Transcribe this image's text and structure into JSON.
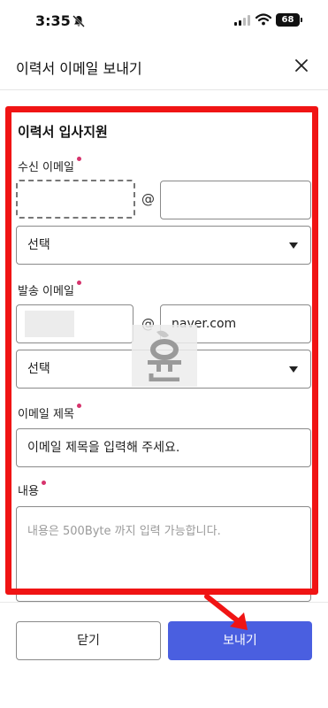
{
  "status_bar": {
    "time": "3:35",
    "battery": "68"
  },
  "header": {
    "title": "이력서 이메일 보내기"
  },
  "form": {
    "section_title": "이력서 입사지원",
    "recipient": {
      "label": "수신 이메일",
      "id_value": "",
      "at": "@",
      "domain_value": "",
      "select_label": "선택"
    },
    "sender": {
      "label": "발송 이메일",
      "at": "@",
      "domain_value": "naver.com",
      "select_label": "선택"
    },
    "subject": {
      "label": "이메일 제목",
      "value": "이메일 제목을 입력해 주세요."
    },
    "body": {
      "label": "내용",
      "placeholder": "내용은 500Byte 까지 입력 가능합니다."
    }
  },
  "footer": {
    "close_label": "닫기",
    "send_label": "보내기"
  },
  "watermark": {
    "text": "윤"
  },
  "colors": {
    "primary": "#4a5fe0",
    "highlight": "#f01414",
    "required_dot": "#d6336c",
    "border": "#8a8a8a"
  }
}
